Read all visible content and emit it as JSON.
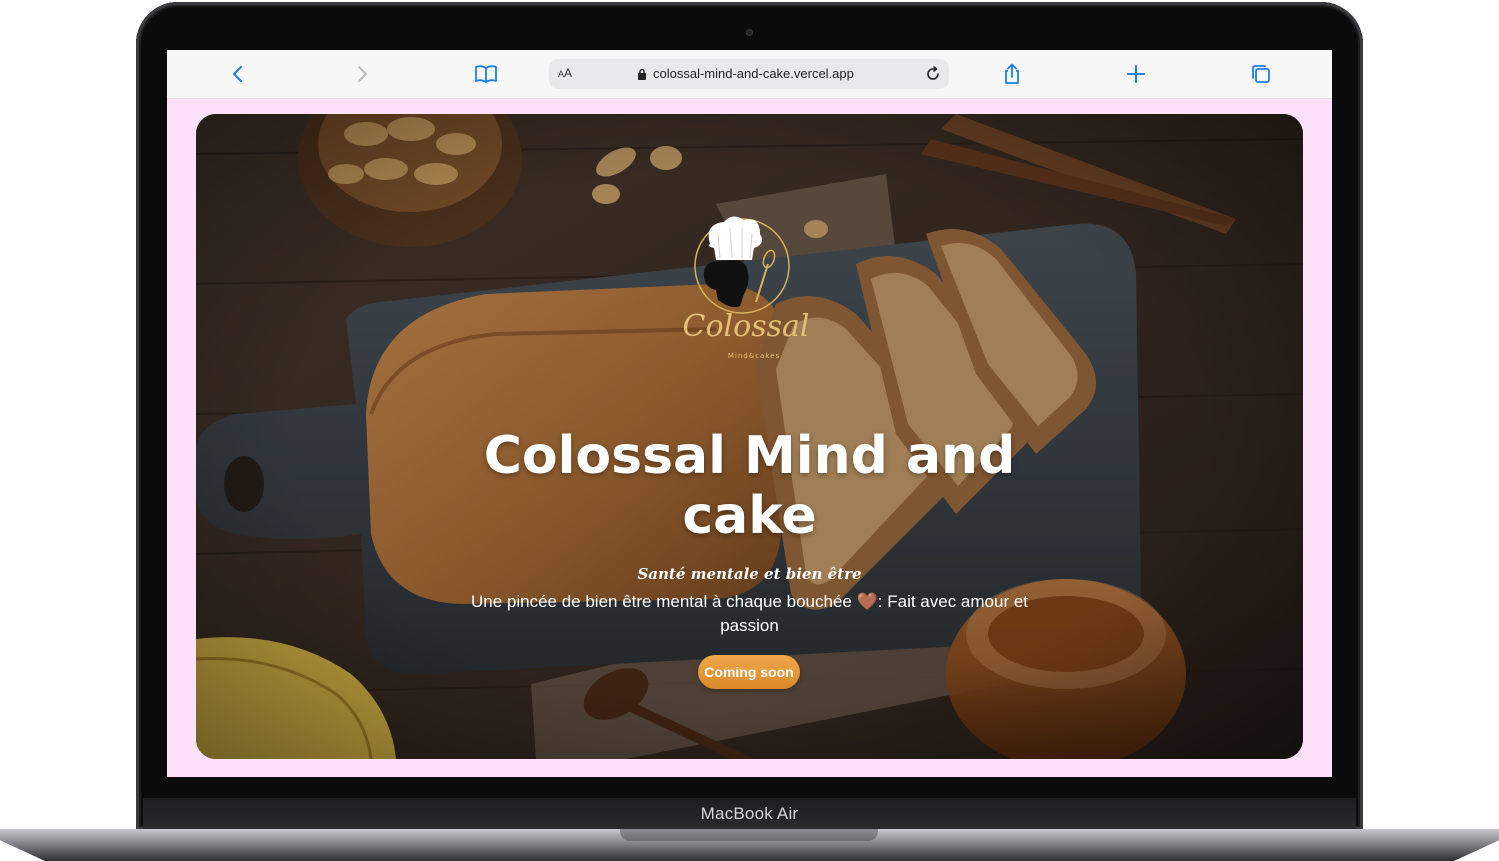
{
  "browser": {
    "reader_label": "AA",
    "url": "colossal-mind-and-cake.vercel.app"
  },
  "hero": {
    "logo_script": "Colossal",
    "logo_tagline": "Mind&cakes",
    "title": "Colossal Mind and cake",
    "subtitle": "Santé mentale et bien être",
    "description": "Une pincée de bien être mental à chaque bouchée",
    "heart": "🤎",
    "description_tail": ": Fait avec amour et passion",
    "cta_label": "Coming soon"
  },
  "device": {
    "label": "MacBook Air"
  },
  "colors": {
    "page_background": "#fce1f8",
    "cta": "#e39632",
    "toolbar_icon": "#1a7df0"
  },
  "icons": [
    "back-arrow-icon",
    "forward-arrow-icon",
    "bookmarks-icon",
    "lock-icon",
    "reload-icon",
    "share-icon",
    "new-tab-icon",
    "tabs-icon"
  ]
}
